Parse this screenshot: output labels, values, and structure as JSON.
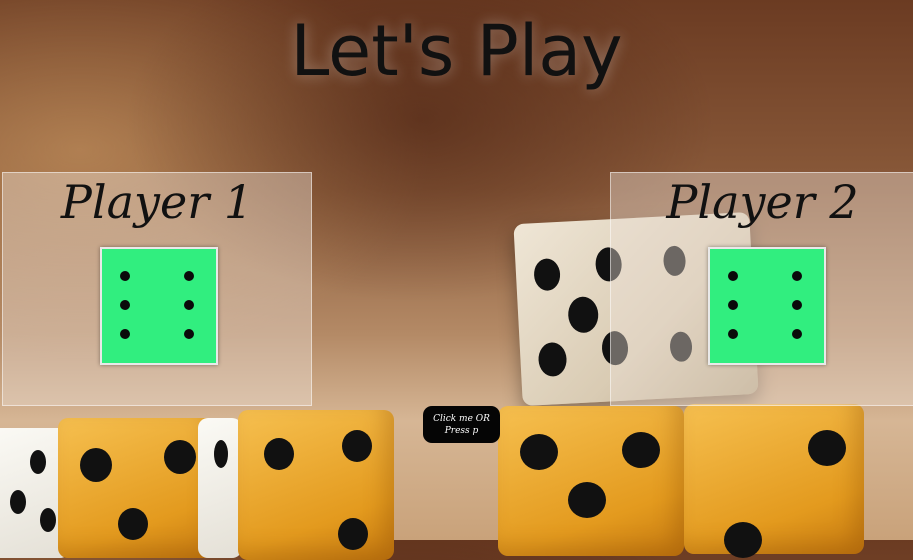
{
  "game": {
    "title": "Let's Play",
    "players": [
      {
        "name": "Player 1",
        "die_value": 6
      },
      {
        "name": "Player 2",
        "die_value": 6
      }
    ],
    "roll_button": {
      "line1": "Click me OR",
      "line2": "Press p"
    }
  },
  "colors": {
    "die_face": "#31ee7f",
    "pip": "#0a0a0a",
    "button_bg": "#050505"
  }
}
